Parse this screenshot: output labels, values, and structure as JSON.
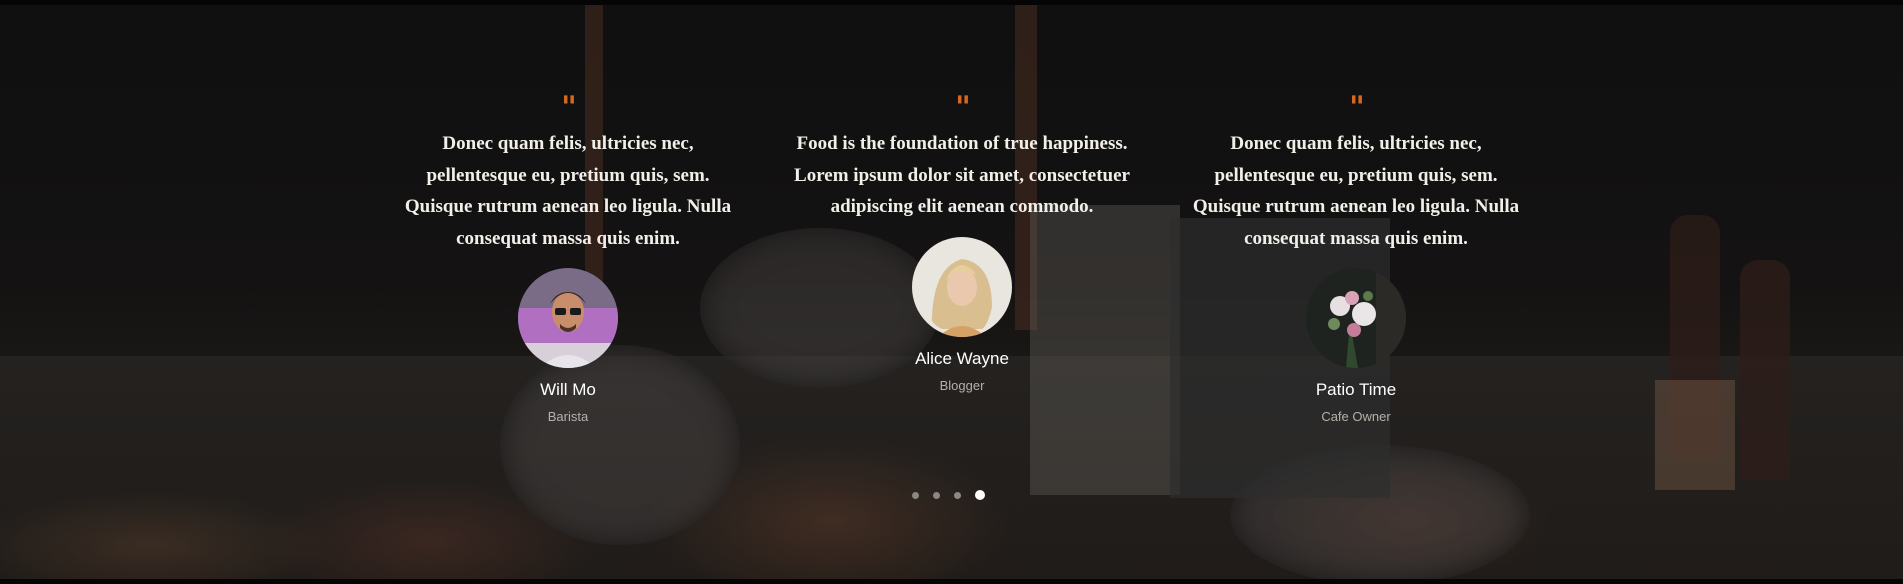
{
  "colors": {
    "accent": "#d2691e",
    "quote_text": "#f2efe9",
    "name_text": "#ffffff",
    "role_text": "#b5b0aa",
    "dot_inactive": "#8a8785",
    "dot_active": "#ffffff"
  },
  "testimonials": [
    {
      "quote_mark": "\"",
      "quote": "Donec quam felis, ultricies nec, pellentesque eu, pretium quis, sem. Quisque rutrum aenean leo ligula. Nulla consequat massa quis enim.",
      "name": "Will Mo",
      "role": "Barista",
      "avatar_icon": "man-with-glasses-portrait"
    },
    {
      "quote_mark": "\"",
      "quote": "Food is the foundation of true happiness. Lorem ipsum dolor sit amet, consectetuer adipiscing elit aenean commodo.",
      "name": "Alice Wayne",
      "role": "Blogger",
      "avatar_icon": "blonde-woman-portrait"
    },
    {
      "quote_mark": "\"",
      "quote": "Donec quam felis, ultricies nec, pellentesque eu, pretium quis, sem. Quisque rutrum aenean leo ligula. Nulla consequat massa quis enim.",
      "name": "Patio Time",
      "role": "Cafe Owner",
      "avatar_icon": "flower-bouquet-photo"
    }
  ],
  "carousel": {
    "dot_count": 4,
    "active_index": 3
  }
}
